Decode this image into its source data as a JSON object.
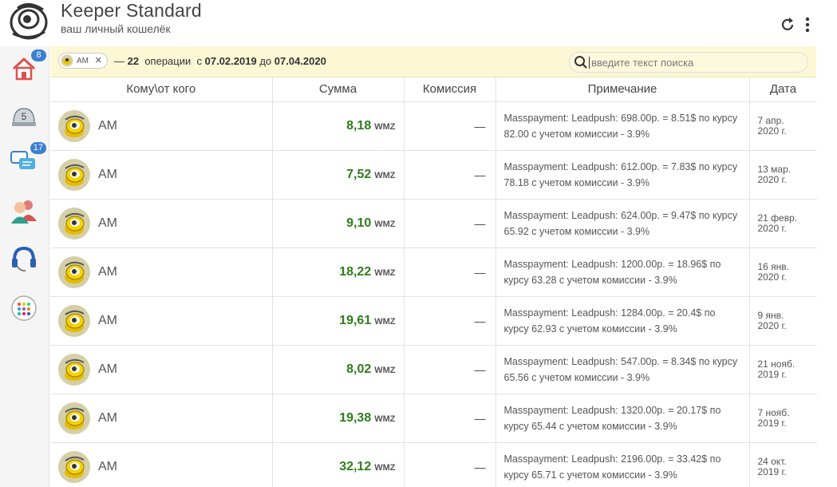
{
  "header": {
    "title": "Keeper Standard",
    "subtitle": "ваш личный кошелёк",
    "refresh_icon": "refresh-icon",
    "menu_icon": "more-vertical-icon"
  },
  "sidebar": {
    "items": [
      {
        "icon": "home-icon",
        "badge": "8"
      },
      {
        "icon": "safe-icon",
        "label": "5"
      },
      {
        "icon": "messages-icon",
        "badge": "17"
      },
      {
        "icon": "contacts-icon"
      },
      {
        "icon": "support-headset-icon"
      },
      {
        "icon": "apps-icon"
      }
    ]
  },
  "filter": {
    "chip_label": "AM",
    "dash": "—",
    "count": "22",
    "count_label": "операции",
    "from_label": "с",
    "date_from": "07.02.2019",
    "to_label": "до",
    "date_to": "07.04.2020",
    "search_placeholder": "введите текст поиска"
  },
  "table": {
    "columns": [
      "Кому\\от кого",
      "Сумма",
      "Комиссия",
      "Примечание",
      "Дата"
    ],
    "rows": [
      {
        "who": "AM",
        "amount": "8,18",
        "currency": "WMZ",
        "fee": "—",
        "note": "Masspayment: Leadpush: 698.00р. = 8.51$ по курсу 82.00 с учетом комиссии - 3.9%",
        "date_line1": "7 апр.",
        "date_line2": "2020 г."
      },
      {
        "who": "AM",
        "amount": "7,52",
        "currency": "WMZ",
        "fee": "—",
        "note": "Masspayment: Leadpush: 612.00р. = 7.83$ по курсу 78.18 с учетом комиссии - 3.9%",
        "date_line1": "13 мар.",
        "date_line2": "2020 г."
      },
      {
        "who": "AM",
        "amount": "9,10",
        "currency": "WMZ",
        "fee": "—",
        "note": "Masspayment: Leadpush: 624.00р. = 9.47$ по курсу 65.92 с учетом комиссии - 3.9%",
        "date_line1": "21 февр.",
        "date_line2": "2020 г."
      },
      {
        "who": "AM",
        "amount": "18,22",
        "currency": "WMZ",
        "fee": "—",
        "note": "Masspayment: Leadpush: 1200.00р. = 18.96$ по курсу 63.28 с учетом комиссии - 3.9%",
        "date_line1": "16 янв.",
        "date_line2": "2020 г."
      },
      {
        "who": "AM",
        "amount": "19,61",
        "currency": "WMZ",
        "fee": "—",
        "note": "Masspayment: Leadpush: 1284.00р. = 20.4$ по курсу 62.93 с учетом комиссии - 3.9%",
        "date_line1": "9 янв.",
        "date_line2": "2020 г."
      },
      {
        "who": "AM",
        "amount": "8,02",
        "currency": "WMZ",
        "fee": "—",
        "note": "Masspayment: Leadpush: 547.00р. = 8.34$ по курсу 65.56 с учетом комиссии - 3.9%",
        "date_line1": "21 нояб.",
        "date_line2": "2019 г."
      },
      {
        "who": "AM",
        "amount": "19,38",
        "currency": "WMZ",
        "fee": "—",
        "note": "Masspayment: Leadpush: 1320.00р. = 20.17$ по курсу 65.44 с учетом комиссии - 3.9%",
        "date_line1": "7 нояб.",
        "date_line2": "2019 г."
      },
      {
        "who": "AM",
        "amount": "32,12",
        "currency": "WMZ",
        "fee": "—",
        "note": "Masspayment: Leadpush: 2196.00р. = 33.42$ по курсу 65.71 с учетом комиссии - 3.9%",
        "date_line1": "24 окт.",
        "date_line2": "2019 г."
      }
    ]
  },
  "colors": {
    "accent_blue": "#3a7fd0",
    "amount_green": "#2e7d1a",
    "filter_bg": "#fcf8d5",
    "sidebar_bg": "#f5f5f5"
  }
}
